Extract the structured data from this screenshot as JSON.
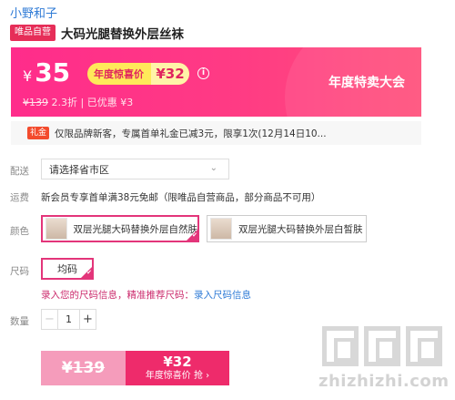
{
  "store": {
    "name": "小野和子"
  },
  "product": {
    "badge": "唯品自营",
    "title": "大码光腿替换外层丝袜"
  },
  "price_banner": {
    "currency": "¥",
    "price": "35",
    "promo_label": "年度惊喜价",
    "promo_price": "¥32",
    "info_icon": "i",
    "original_price": "¥139",
    "discount_text": "2.3折 | 已优惠 ¥3",
    "event_name": "年度特卖大会",
    "colors": {
      "banner": "#ff2c8b",
      "promo_pill": "#ffe95a"
    }
  },
  "gift": {
    "tag": "礼金",
    "text": "仅限品牌新客，专属首单礼金已减3元，限享1次(12月14日10..."
  },
  "delivery": {
    "label": "配送",
    "select_value": "请选择省市区",
    "chevron": "⌄"
  },
  "shipping": {
    "label": "运费",
    "text": "新会员专享首单满38元免邮（限唯品自营商品，部分商品不可用）"
  },
  "colors_section": {
    "label": "颜色",
    "options": [
      {
        "label": "双层光腿大码替换外层自然肤",
        "selected": true
      },
      {
        "label": "双层光腿大码替换外层白皙肤",
        "selected": false
      }
    ],
    "check": "✔"
  },
  "size_section": {
    "label": "尺码",
    "options": [
      {
        "label": "均码",
        "selected": true
      }
    ],
    "tip_prefix": "录入您的尺码信息，精准推荐尺码：",
    "tip_link": "录入尺码信息"
  },
  "quantity": {
    "label": "数量",
    "value": "1",
    "minus": "−",
    "plus": "+"
  },
  "buy": {
    "original_price": "¥139",
    "promo_price": "¥32",
    "promo_label": "年度惊喜价 抢 ›",
    "accent": "#ee2b6b"
  },
  "watermark": {
    "text": "zhizhizhi.com"
  }
}
